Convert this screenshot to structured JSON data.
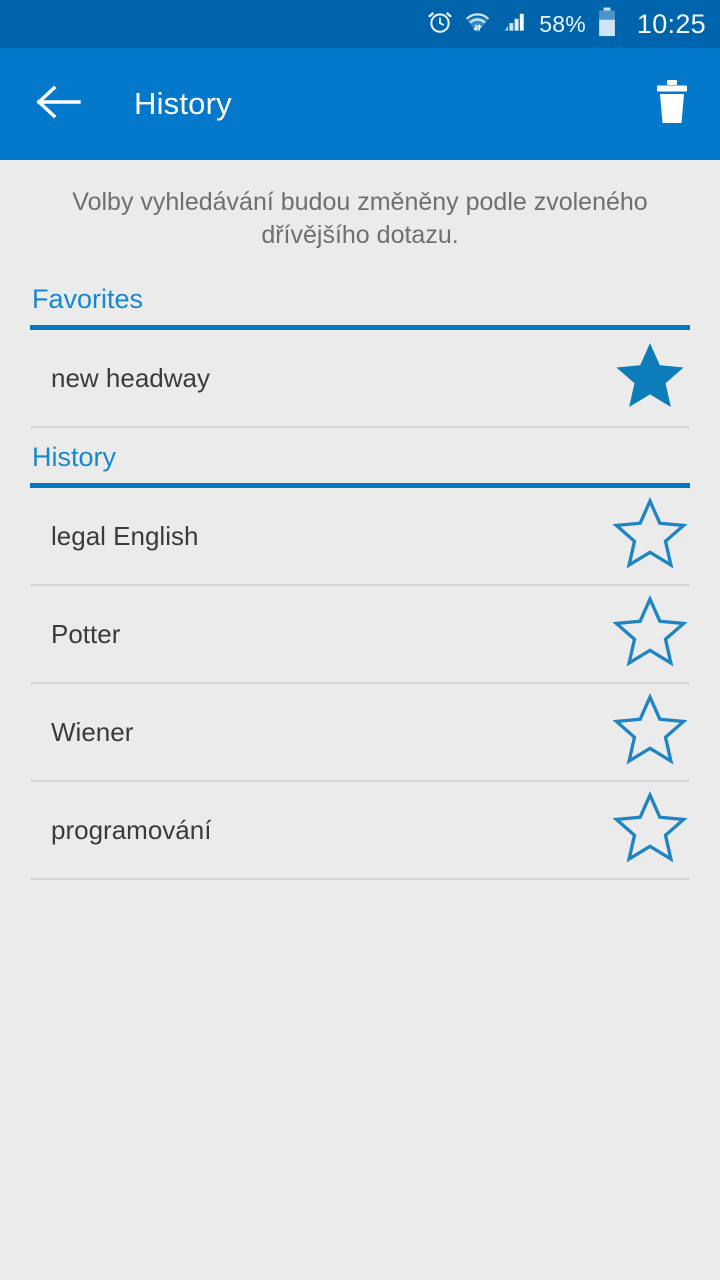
{
  "status_bar": {
    "icons": [
      "alarm-icon",
      "wifi-icon",
      "signal-icon"
    ],
    "battery_percent": "58%",
    "battery_icon": "battery-icon",
    "time": "10:25"
  },
  "app_bar": {
    "back_icon": "back-arrow-icon",
    "title": "History",
    "delete_icon": "trash-icon"
  },
  "hint": {
    "text": "Volby vyhledávání budou změněny podle zvoleného dřívějšího dotazu."
  },
  "sections": [
    {
      "title": "Favorites",
      "rows": [
        {
          "label": "new headway",
          "starred": true,
          "star_icon": "star-filled-icon"
        }
      ]
    },
    {
      "title": "History",
      "rows": [
        {
          "label": "legal English",
          "starred": false,
          "star_icon": "star-outline-icon"
        },
        {
          "label": "Potter",
          "starred": false,
          "star_icon": "star-outline-icon"
        },
        {
          "label": "Wiener",
          "starred": false,
          "star_icon": "star-outline-icon"
        },
        {
          "label": "programování",
          "starred": false,
          "star_icon": "star-outline-icon"
        }
      ]
    }
  ],
  "colors": {
    "status_bar": "#0064ac",
    "app_bar": "#0479cc",
    "accent": "#0477bf",
    "section_title": "#1589ce",
    "star": "#0c7cba",
    "background": "#ebebeb"
  }
}
